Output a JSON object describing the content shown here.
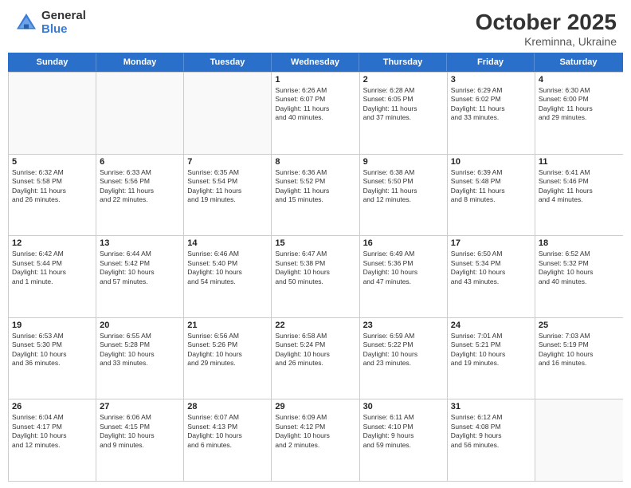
{
  "header": {
    "logo_general": "General",
    "logo_blue": "Blue",
    "month_title": "October 2025",
    "location": "Kreminna, Ukraine"
  },
  "days_of_week": [
    "Sunday",
    "Monday",
    "Tuesday",
    "Wednesday",
    "Thursday",
    "Friday",
    "Saturday"
  ],
  "weeks": [
    [
      {
        "day": "",
        "info": ""
      },
      {
        "day": "",
        "info": ""
      },
      {
        "day": "",
        "info": ""
      },
      {
        "day": "1",
        "info": "Sunrise: 6:26 AM\nSunset: 6:07 PM\nDaylight: 11 hours\nand 40 minutes."
      },
      {
        "day": "2",
        "info": "Sunrise: 6:28 AM\nSunset: 6:05 PM\nDaylight: 11 hours\nand 37 minutes."
      },
      {
        "day": "3",
        "info": "Sunrise: 6:29 AM\nSunset: 6:02 PM\nDaylight: 11 hours\nand 33 minutes."
      },
      {
        "day": "4",
        "info": "Sunrise: 6:30 AM\nSunset: 6:00 PM\nDaylight: 11 hours\nand 29 minutes."
      }
    ],
    [
      {
        "day": "5",
        "info": "Sunrise: 6:32 AM\nSunset: 5:58 PM\nDaylight: 11 hours\nand 26 minutes."
      },
      {
        "day": "6",
        "info": "Sunrise: 6:33 AM\nSunset: 5:56 PM\nDaylight: 11 hours\nand 22 minutes."
      },
      {
        "day": "7",
        "info": "Sunrise: 6:35 AM\nSunset: 5:54 PM\nDaylight: 11 hours\nand 19 minutes."
      },
      {
        "day": "8",
        "info": "Sunrise: 6:36 AM\nSunset: 5:52 PM\nDaylight: 11 hours\nand 15 minutes."
      },
      {
        "day": "9",
        "info": "Sunrise: 6:38 AM\nSunset: 5:50 PM\nDaylight: 11 hours\nand 12 minutes."
      },
      {
        "day": "10",
        "info": "Sunrise: 6:39 AM\nSunset: 5:48 PM\nDaylight: 11 hours\nand 8 minutes."
      },
      {
        "day": "11",
        "info": "Sunrise: 6:41 AM\nSunset: 5:46 PM\nDaylight: 11 hours\nand 4 minutes."
      }
    ],
    [
      {
        "day": "12",
        "info": "Sunrise: 6:42 AM\nSunset: 5:44 PM\nDaylight: 11 hours\nand 1 minute."
      },
      {
        "day": "13",
        "info": "Sunrise: 6:44 AM\nSunset: 5:42 PM\nDaylight: 10 hours\nand 57 minutes."
      },
      {
        "day": "14",
        "info": "Sunrise: 6:46 AM\nSunset: 5:40 PM\nDaylight: 10 hours\nand 54 minutes."
      },
      {
        "day": "15",
        "info": "Sunrise: 6:47 AM\nSunset: 5:38 PM\nDaylight: 10 hours\nand 50 minutes."
      },
      {
        "day": "16",
        "info": "Sunrise: 6:49 AM\nSunset: 5:36 PM\nDaylight: 10 hours\nand 47 minutes."
      },
      {
        "day": "17",
        "info": "Sunrise: 6:50 AM\nSunset: 5:34 PM\nDaylight: 10 hours\nand 43 minutes."
      },
      {
        "day": "18",
        "info": "Sunrise: 6:52 AM\nSunset: 5:32 PM\nDaylight: 10 hours\nand 40 minutes."
      }
    ],
    [
      {
        "day": "19",
        "info": "Sunrise: 6:53 AM\nSunset: 5:30 PM\nDaylight: 10 hours\nand 36 minutes."
      },
      {
        "day": "20",
        "info": "Sunrise: 6:55 AM\nSunset: 5:28 PM\nDaylight: 10 hours\nand 33 minutes."
      },
      {
        "day": "21",
        "info": "Sunrise: 6:56 AM\nSunset: 5:26 PM\nDaylight: 10 hours\nand 29 minutes."
      },
      {
        "day": "22",
        "info": "Sunrise: 6:58 AM\nSunset: 5:24 PM\nDaylight: 10 hours\nand 26 minutes."
      },
      {
        "day": "23",
        "info": "Sunrise: 6:59 AM\nSunset: 5:22 PM\nDaylight: 10 hours\nand 23 minutes."
      },
      {
        "day": "24",
        "info": "Sunrise: 7:01 AM\nSunset: 5:21 PM\nDaylight: 10 hours\nand 19 minutes."
      },
      {
        "day": "25",
        "info": "Sunrise: 7:03 AM\nSunset: 5:19 PM\nDaylight: 10 hours\nand 16 minutes."
      }
    ],
    [
      {
        "day": "26",
        "info": "Sunrise: 6:04 AM\nSunset: 4:17 PM\nDaylight: 10 hours\nand 12 minutes."
      },
      {
        "day": "27",
        "info": "Sunrise: 6:06 AM\nSunset: 4:15 PM\nDaylight: 10 hours\nand 9 minutes."
      },
      {
        "day": "28",
        "info": "Sunrise: 6:07 AM\nSunset: 4:13 PM\nDaylight: 10 hours\nand 6 minutes."
      },
      {
        "day": "29",
        "info": "Sunrise: 6:09 AM\nSunset: 4:12 PM\nDaylight: 10 hours\nand 2 minutes."
      },
      {
        "day": "30",
        "info": "Sunrise: 6:11 AM\nSunset: 4:10 PM\nDaylight: 9 hours\nand 59 minutes."
      },
      {
        "day": "31",
        "info": "Sunrise: 6:12 AM\nSunset: 4:08 PM\nDaylight: 9 hours\nand 56 minutes."
      },
      {
        "day": "",
        "info": ""
      }
    ]
  ]
}
